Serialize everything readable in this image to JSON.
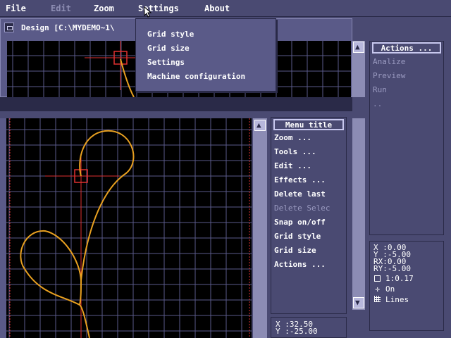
{
  "menubar": {
    "file": "File",
    "edit": "Edit",
    "zoom": "Zoom",
    "settings": "Settings",
    "about": "About"
  },
  "settings_menu": {
    "items": [
      "Grid style",
      "Grid size",
      "Settings",
      "Machine configuration"
    ]
  },
  "design_window": {
    "title": "Design [C:\\MYDEMO~1\\"
  },
  "actions_panel": {
    "title": "Actions ...",
    "items": [
      "Analize",
      "Preview",
      "Run",
      ".."
    ]
  },
  "menu_panel": {
    "title": "Menu title",
    "items": [
      {
        "label": "Zoom ...",
        "enabled": true
      },
      {
        "label": "Tools ...",
        "enabled": true
      },
      {
        "label": "Edit ...",
        "enabled": true
      },
      {
        "label": "Effects ...",
        "enabled": true
      },
      {
        "label": "Delete last",
        "enabled": true
      },
      {
        "label": "Delete Selec",
        "enabled": false
      },
      {
        "label": "Snap on/off",
        "enabled": true
      },
      {
        "label": "Grid style",
        "enabled": true
      },
      {
        "label": "Grid size",
        "enabled": true
      },
      {
        "label": "Actions ...",
        "enabled": true
      }
    ]
  },
  "cursor_coords": {
    "x": "X  :32.50",
    "y": "Y  :-25.00"
  },
  "status_panel": {
    "x": "X  :0.00",
    "y": "Y  :-5.00",
    "rx": "RX:0.00",
    "ry": "RY:-5.00",
    "scale": "1:0.17",
    "snap": "On",
    "grid": "Lines"
  },
  "colors": {
    "desktop": "#4a4a72",
    "canvas": "#000000",
    "grid": "#5a5a8a",
    "curve": "#e8a020",
    "marker": "#e03030"
  }
}
